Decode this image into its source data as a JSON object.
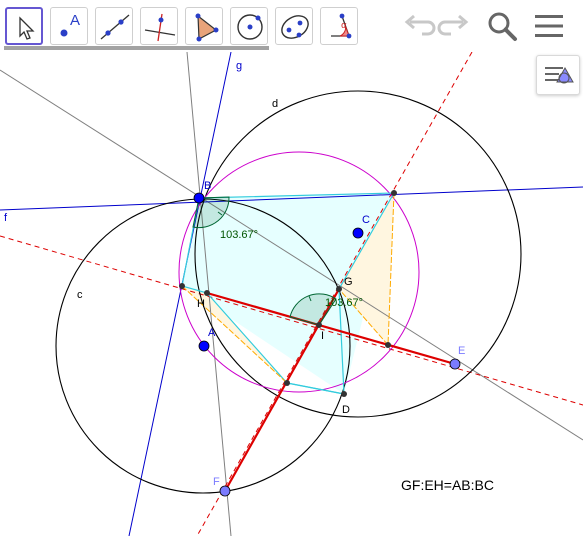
{
  "toolbar": {
    "tools": [
      {
        "name": "move-tool-button",
        "icon": "cursor-arrow-icon",
        "selected": true
      },
      {
        "name": "point-tool-button",
        "icon": "point-icon",
        "glyph": "A"
      },
      {
        "name": "line-tool-button",
        "icon": "line-through-points-icon"
      },
      {
        "name": "perpendicular-line-tool-button",
        "icon": "perpendicular-line-icon"
      },
      {
        "name": "polygon-tool-button",
        "icon": "polygon-icon"
      },
      {
        "name": "circle-tool-button",
        "icon": "circle-center-point-icon"
      },
      {
        "name": "conic-tool-button",
        "icon": "ellipse-icon"
      },
      {
        "name": "angle-tool-button",
        "icon": "angle-icon",
        "glyph": "α"
      }
    ],
    "undo": {
      "icon": "undo-icon",
      "enabled": false
    },
    "redo": {
      "icon": "redo-icon",
      "enabled": false
    },
    "search": {
      "icon": "search-icon"
    },
    "menu": {
      "icon": "hamburger-menu-icon"
    }
  },
  "style_bar": {
    "icon": "graphics-style-bar-icon"
  },
  "colors": {
    "accent": "#6557d2",
    "selection_bar": "#a3a3a3",
    "circle": "#000000",
    "circumcircle": "#cc00cc",
    "line_blue": "#0000cc",
    "line_gray": "#808080",
    "dashed_red": "#dd0000",
    "segment_red": "#dd0000",
    "polygon_fill": "#e6ffff",
    "polygon_edge": "#33ccdd",
    "triangle_fill": "#fff6e0",
    "triangle_edge": "#ffaa00",
    "angle_fill": "#006633",
    "angle_text": "#005500",
    "point_blue": "#0000ff",
    "point_lavender": "#7b7bff"
  },
  "labels": {
    "point_b": "B",
    "point_c": "C",
    "point_a": "A",
    "point_g": "G",
    "point_h": "H",
    "point_i": "I",
    "point_d": "D",
    "point_e": "E",
    "point_f": "F",
    "line_g": "g",
    "line_f": "f",
    "circle_d": "d",
    "circle_c": "c",
    "angle_at_b": "103.67°",
    "angle_at_i": "103.67°",
    "relation_text": "GF:EH=AB:BC"
  }
}
